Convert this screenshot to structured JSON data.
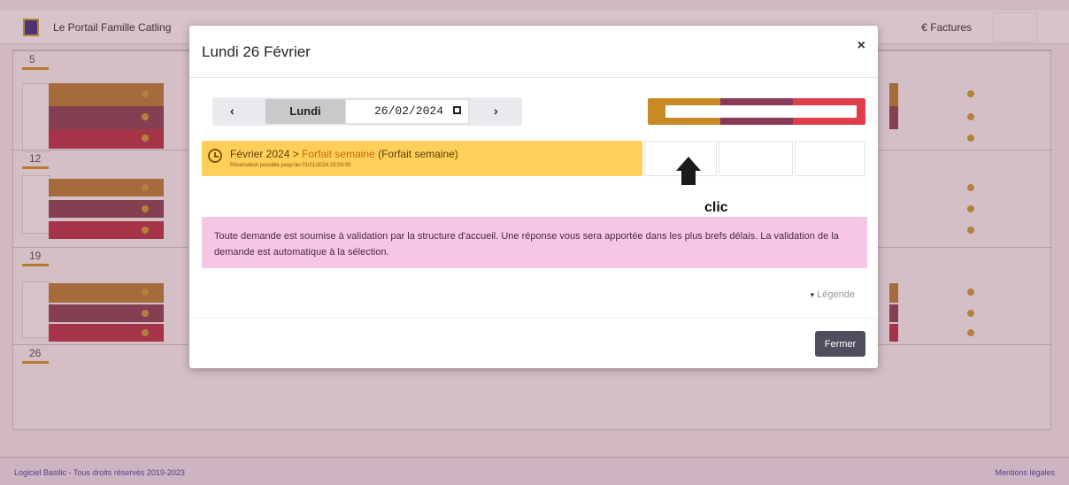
{
  "app": {
    "title": "Le Portail Famille Catling",
    "header_right": "€ Factures",
    "footer_left": "Logiciel Basilic - Tous droits réservés 2019-2023",
    "footer_right": "Mentions légales"
  },
  "calendar": {
    "weeks": [
      "5",
      "12",
      "19",
      "26"
    ]
  },
  "modal": {
    "title": "Lundi 26 Février",
    "close_symbol": "×",
    "nav": {
      "prev_symbol": "‹",
      "day": "Lundi",
      "date_value": "26/02/2024",
      "next_symbol": "›"
    },
    "banner": {
      "period": "Février 2024",
      "separator": " > ",
      "plan_link": "Forfait semaine",
      "plan_suffix": " (Forfait semaine)",
      "small_label": "Réservation possible",
      "small_date": "jusqu'au 01/01/2024 23:59:00"
    },
    "annotation": "clic",
    "notice": "Toute demande est soumise à validation par la structure d'accueil. Une réponse vous sera apportée dans les plus brefs délais. La validation de la demande est automatique à la sélection.",
    "legend_label": "Légende",
    "close_button": "Fermer"
  },
  "colors": {
    "accent_gold": "#c98a25",
    "accent_plum": "#8a3a55",
    "accent_red": "#e03e4a",
    "banner_yellow": "#ffcf5a",
    "notice_pink": "#f7c5e6"
  }
}
